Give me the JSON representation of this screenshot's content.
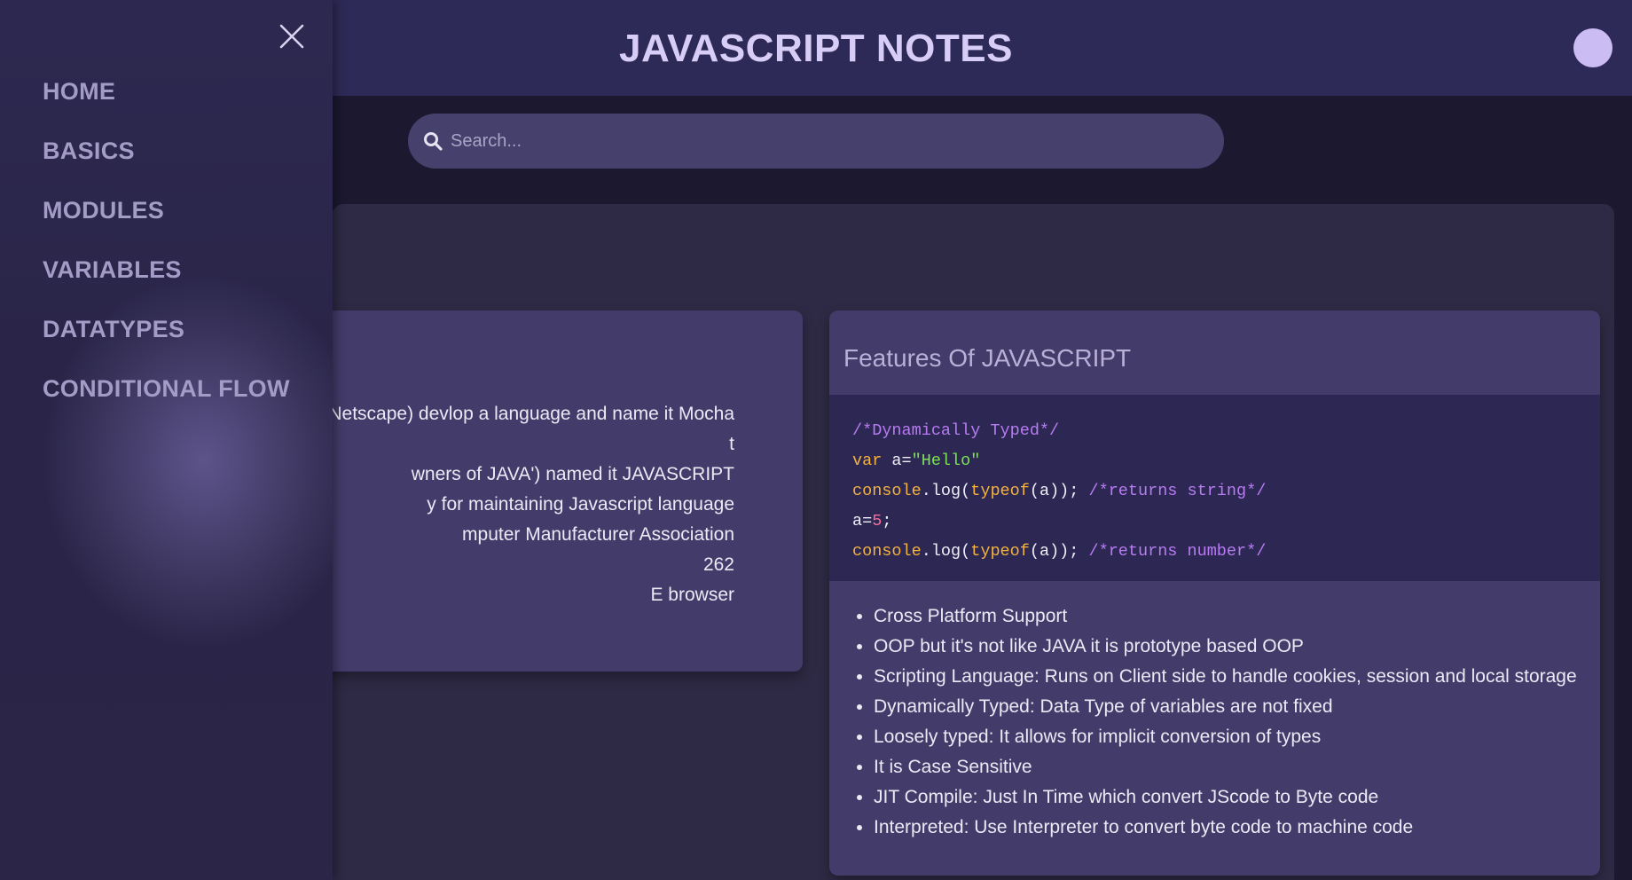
{
  "header": {
    "title": "JAVASCRIPT NOTES"
  },
  "search": {
    "placeholder": "Search..."
  },
  "sidebar": {
    "items": [
      {
        "label": "HOME"
      },
      {
        "label": "BASICS"
      },
      {
        "label": "MODULES"
      },
      {
        "label": "VARIABLES"
      },
      {
        "label": "DATATYPES"
      },
      {
        "label": "CONDITIONAL FLOW"
      }
    ],
    "close_icon": "close-icon"
  },
  "history_card": {
    "lines": [
      "nt Netscape) devlop a language and name it Mocha",
      "t",
      "wners of JAVA') named it JAVASCRIPT",
      "y for maintaining Javascript language",
      "mputer Manufacturer Association",
      "262",
      "E browser"
    ]
  },
  "features_card": {
    "title": "Features Of JAVASCRIPT",
    "code": {
      "line1_comment": "/*Dynamically Typed*/",
      "line2_kw": "var",
      "line2_mid": " a=",
      "line2_str": "\"Hello\"",
      "line3_console": "console",
      "line3_log": ".log(",
      "line3_typeof": "typeof",
      "line3_args": "(a)); ",
      "line3_comment": "/*returns string*/",
      "line4_a": "a=",
      "line4_num": "5",
      "line4_end": ";",
      "line5_console": "console",
      "line5_log": ".log(",
      "line5_typeof": "typeof",
      "line5_args": "(a)); ",
      "line5_comment": "/*returns number*/"
    },
    "items": [
      "Cross Platform Support",
      "OOP but it's not like JAVA it is prototype based OOP",
      "Scripting Language: Runs on Client side to handle cookies, session and local storage",
      "Dynamically Typed: Data Type of variables are not fixed",
      "Loosely typed: It allows for implicit conversion of types",
      "It is Case Sensitive",
      "JIT Compile: Just In Time which convert JScode to Byte code",
      "Interpreted: Use Interpreter to convert byte code to machine code"
    ]
  },
  "colors": {
    "header_bg": "#2e2a57",
    "card_bg": "#433c6b",
    "code_bg": "#2c2853",
    "code_comment": "#b87bf2",
    "code_keyword": "#f4b23e",
    "code_string": "#7be34f",
    "code_number": "#f56e9c"
  }
}
